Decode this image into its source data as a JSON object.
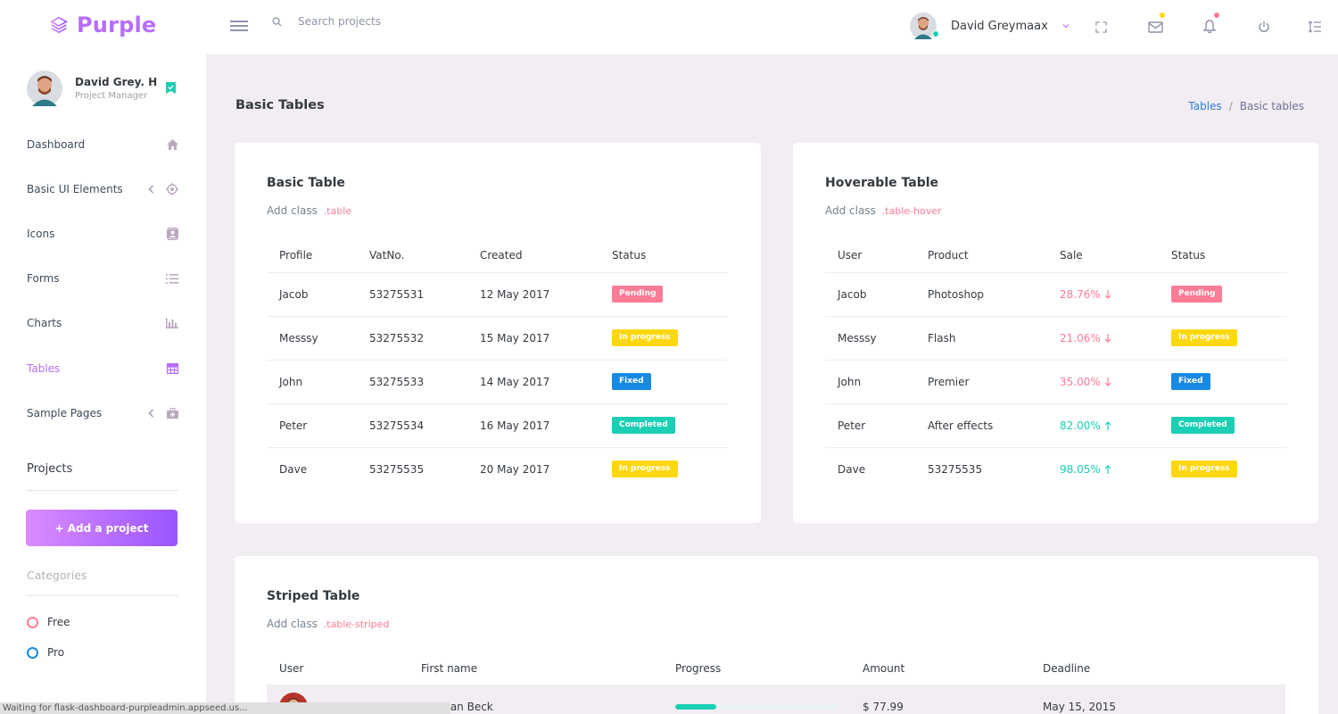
{
  "brand": {
    "name": "Purple"
  },
  "search": {
    "placeholder": "Search projects"
  },
  "user": {
    "name": "David Greymaax",
    "sidebar_name": "David Grey. H",
    "role": "Project Manager"
  },
  "sidebar": {
    "items": [
      {
        "label": "Dashboard",
        "icon": "home-icon"
      },
      {
        "label": "Basic UI Elements",
        "icon": "crosshairs-icon"
      },
      {
        "label": "Icons",
        "icon": "contacts-icon"
      },
      {
        "label": "Forms",
        "icon": "format-list-icon"
      },
      {
        "label": "Charts",
        "icon": "chart-bar-icon"
      },
      {
        "label": "Tables",
        "icon": "table-icon"
      },
      {
        "label": "Sample Pages",
        "icon": "medical-bag-icon"
      }
    ],
    "projects_title": "Projects",
    "add_project_label": "+ Add a project",
    "categories_title": "Categories",
    "categories": [
      {
        "label": "Free",
        "color": "#fe7c96"
      },
      {
        "label": "Pro",
        "color": "#198ae3"
      }
    ]
  },
  "page": {
    "title": "Basic Tables",
    "breadcrumb": {
      "link": "Tables",
      "separator": "/",
      "current": "Basic tables"
    }
  },
  "basic_table": {
    "title": "Basic Table",
    "desc": "Add class",
    "code": ".table",
    "headers": [
      "Profile",
      "VatNo.",
      "Created",
      "Status"
    ],
    "rows": [
      {
        "profile": "Jacob",
        "vat": "53275531",
        "created": "12 May 2017",
        "status": "Pending"
      },
      {
        "profile": "Messsy",
        "vat": "53275532",
        "created": "15 May 2017",
        "status": "In progress"
      },
      {
        "profile": "John",
        "vat": "53275533",
        "created": "14 May 2017",
        "status": "Fixed"
      },
      {
        "profile": "Peter",
        "vat": "53275534",
        "created": "16 May 2017",
        "status": "Completed"
      },
      {
        "profile": "Dave",
        "vat": "53275535",
        "created": "20 May 2017",
        "status": "In progress"
      }
    ]
  },
  "hover_table": {
    "title": "Hoverable Table",
    "desc": "Add class",
    "code": ".table-hover",
    "headers": [
      "User",
      "Product",
      "Sale",
      "Status"
    ],
    "rows": [
      {
        "user": "Jacob",
        "product": "Photoshop",
        "sale": "28.76%",
        "trend": "down",
        "status": "Pending"
      },
      {
        "user": "Messsy",
        "product": "Flash",
        "sale": "21.06%",
        "trend": "down",
        "status": "In progress"
      },
      {
        "user": "John",
        "product": "Premier",
        "sale": "35.00%",
        "trend": "down",
        "status": "Fixed"
      },
      {
        "user": "Peter",
        "product": "After effects",
        "sale": "82.00%",
        "trend": "up",
        "status": "Completed"
      },
      {
        "user": "Dave",
        "product": "53275535",
        "sale": "98.05%",
        "trend": "up",
        "status": "In progress"
      }
    ]
  },
  "striped_table": {
    "title": "Striped Table",
    "desc": "Add class",
    "code": ".table-striped",
    "headers": [
      "User",
      "First name",
      "Progress",
      "Amount",
      "Deadline"
    ],
    "rows": [
      {
        "first_name": "Herman Beck",
        "progress": 0.25,
        "amount": "$ 77.99",
        "deadline": "May 15, 2015"
      }
    ]
  },
  "status_colors": {
    "Pending": "#fe7c96",
    "In progress": "#fed713",
    "Fixed": "#198ae3",
    "Completed": "#1bcfb4"
  },
  "colors": {
    "accent": "#b66dff",
    "sale_down": "#fe7c96",
    "sale_up": "#1bcfb4"
  },
  "statusbar": {
    "text": "Waiting for flask-dashboard-purpleadmin.appseed.us..."
  }
}
